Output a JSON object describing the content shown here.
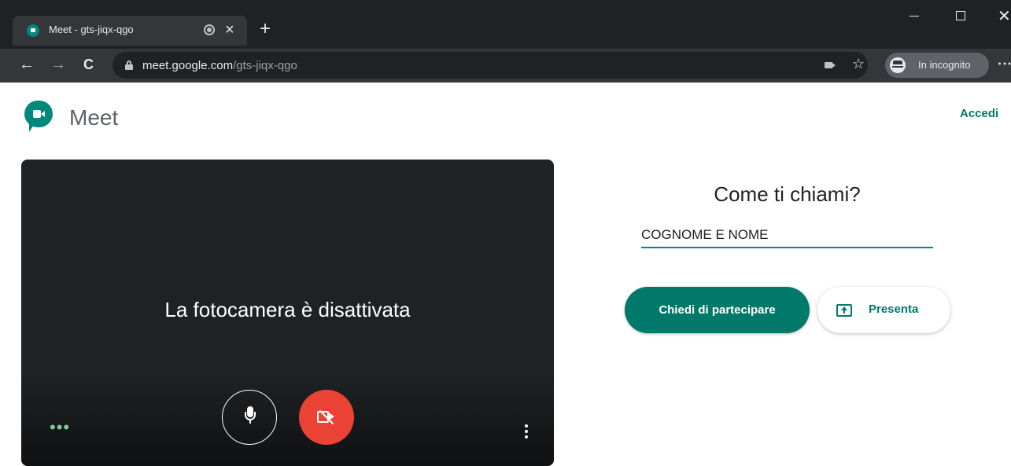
{
  "browser": {
    "tab_title": "Meet - gts-jiqx-qgo",
    "tab_close": "×",
    "new_tab": "+",
    "url_host": "meet.google.com",
    "url_path": "/gts-jiqx-qgo",
    "incognito_label": "In incognito",
    "window_close": "✕",
    "back": "←",
    "forward": "→",
    "reload": "C",
    "bookmark_star": "☆"
  },
  "header": {
    "app_name": "Meet",
    "sign_in": "Accedi"
  },
  "preview": {
    "camera_off_text": "La fotocamera è disattivata",
    "effects_dots": "•••"
  },
  "join": {
    "prompt": "Come ti chiami?",
    "name_value": "COGNOME E NOME",
    "join_button": "Chiedi di partecipare",
    "present_button": "Presenta"
  },
  "colors": {
    "accent": "#00796b",
    "camera_off_red": "#ea4335",
    "dark_panel": "#202124"
  }
}
